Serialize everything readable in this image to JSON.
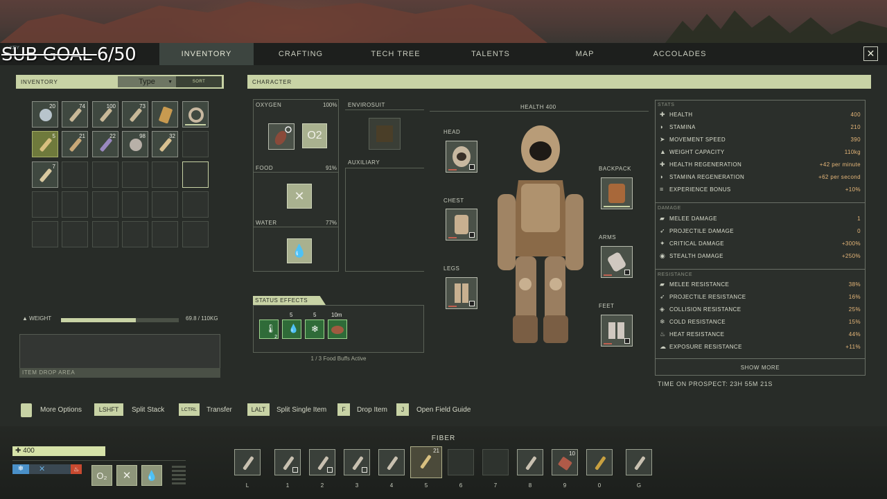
{
  "overlay": {
    "sub_goal": "SUB GOAL ",
    "sub_goal_progress": "6/50",
    "key_hint": "KEY"
  },
  "nav": {
    "tabs": [
      "INVENTORY",
      "CRAFTING",
      "TECH TREE",
      "TALENTS",
      "MAP",
      "ACCOLADES"
    ],
    "active": "INVENTORY",
    "close_label": "✕"
  },
  "inventory": {
    "header": "INVENTORY",
    "type_select": "Type",
    "sort_label": "SORT",
    "slots": [
      {
        "item": "crystal-ore",
        "count": "20",
        "color": "#b8c4cc"
      },
      {
        "item": "arrow-bundle",
        "count": "74",
        "color": "#c8b898"
      },
      {
        "item": "arrow-bundle",
        "count": "100",
        "color": "#c8b898"
      },
      {
        "item": "arrow-bundle",
        "count": "73",
        "color": "#c8b898"
      },
      {
        "item": "bark-slab",
        "count": "",
        "color": "#c89a50"
      },
      {
        "item": "bone-ring",
        "count": "",
        "color": "#c8b8a0"
      },
      {
        "item": "fiber-bundle",
        "count": "5",
        "color": "#d8c080"
      },
      {
        "item": "arrow-bundle",
        "count": "21",
        "color": "#c8a878"
      },
      {
        "item": "arrow-bundle",
        "count": "22",
        "color": "#9a88c0"
      },
      {
        "item": "stone-ore",
        "count": "98",
        "color": "#b8b0a8"
      },
      {
        "item": "bone",
        "count": "32",
        "color": "#d8c090"
      },
      {
        "item": "",
        "count": "",
        "color": ""
      },
      {
        "item": "bone-club",
        "count": "7",
        "color": "#d8c8a0"
      }
    ],
    "weight_label": "WEIGHT",
    "weight_fraction": 0.634,
    "weight_value": "69.8 / 110KG",
    "drop_area_label": "ITEM DROP AREA"
  },
  "key_hints": [
    {
      "key": "",
      "label": "More Options"
    },
    {
      "key": "LSHFT",
      "label": "Split Stack"
    },
    {
      "key": "LCTRL",
      "label": "Transfer"
    },
    {
      "key": "LALT",
      "label": "Split Single Item"
    },
    {
      "key": "F",
      "label": "Drop Item"
    },
    {
      "key": "J",
      "label": "Open Field Guide"
    }
  ],
  "character": {
    "header": "CHARACTER",
    "oxygen": {
      "label": "OXYGEN",
      "value": "100%",
      "tile_text": "O2"
    },
    "food": {
      "label": "FOOD",
      "value": "91%"
    },
    "water": {
      "label": "WATER",
      "value": "77%"
    },
    "envirosuit_label": "ENVIROSUIT",
    "auxiliary_label": "AUXILIARY",
    "health_label": "HEALTH 400",
    "slots": {
      "head": "HEAD",
      "chest": "CHEST",
      "legs": "LEGS",
      "backpack": "BACKPACK",
      "arms": "ARMS",
      "feet": "FEET"
    },
    "status_effects_label": "STATUS EFFECTS",
    "status_effects": [
      {
        "name": "temperature",
        "num": "",
        "sub": "2"
      },
      {
        "name": "water",
        "num": "5",
        "sub": ""
      },
      {
        "name": "cold",
        "num": "5",
        "sub": ""
      },
      {
        "name": "food",
        "num": "10m",
        "sub": ""
      }
    ],
    "food_buffs": "1 / 3 Food Buffs Active"
  },
  "stats": {
    "section_stats": "STATS",
    "stats": [
      {
        "icon": "✚",
        "name": "HEALTH",
        "value": "400"
      },
      {
        "icon": "◗",
        "name": "STAMINA",
        "value": "210"
      },
      {
        "icon": "➤",
        "name": "MOVEMENT SPEED",
        "value": "390"
      },
      {
        "icon": "▲",
        "name": "WEIGHT CAPACITY",
        "value": "110kg"
      },
      {
        "icon": "✚",
        "name": "HEALTH REGENERATION",
        "value": "+42 per minute"
      },
      {
        "icon": "◗",
        "name": "STAMINA REGENERATION",
        "value": "+62 per second"
      },
      {
        "icon": "≡",
        "name": "EXPERIENCE BONUS",
        "value": "+10%"
      }
    ],
    "section_damage": "DAMAGE",
    "damage": [
      {
        "icon": "▰",
        "name": "MELEE DAMAGE",
        "value": "1"
      },
      {
        "icon": "➶",
        "name": "PROJECTILE DAMAGE",
        "value": "0"
      },
      {
        "icon": "✦",
        "name": "CRITICAL DAMAGE",
        "value": "+300%"
      },
      {
        "icon": "◉",
        "name": "STEALTH DAMAGE",
        "value": "+250%"
      }
    ],
    "section_resistance": "RESISTANCE",
    "resistance": [
      {
        "icon": "▰",
        "name": "MELEE RESISTANCE",
        "value": "38%"
      },
      {
        "icon": "➶",
        "name": "PROJECTILE RESISTANCE",
        "value": "16%"
      },
      {
        "icon": "◈",
        "name": "COLLISION RESISTANCE",
        "value": "25%"
      },
      {
        "icon": "❄",
        "name": "COLD RESISTANCE",
        "value": "15%"
      },
      {
        "icon": "♨",
        "name": "HEAT RESISTANCE",
        "value": "44%"
      },
      {
        "icon": "☁",
        "name": "EXPOSURE RESISTANCE",
        "value": "+11%"
      }
    ],
    "show_more": "SHOW MORE",
    "time_on_prospect": "TIME ON PROSPECT: 23H 55M 21S"
  },
  "hotbar": {
    "selected_item_name": "FIBER",
    "slots": [
      {
        "key": "L",
        "item": "torch",
        "count": "",
        "sq": false
      },
      {
        "key": "1",
        "item": "knife",
        "count": "",
        "sq": true
      },
      {
        "key": "2",
        "item": "pickaxe",
        "count": "",
        "sq": true
      },
      {
        "key": "3",
        "item": "axe",
        "count": "",
        "sq": true
      },
      {
        "key": "4",
        "item": "spear",
        "count": "",
        "sq": false
      },
      {
        "key": "5",
        "item": "fiber",
        "count": "21",
        "sq": false
      },
      {
        "key": "6",
        "item": "",
        "count": "",
        "sq": false
      },
      {
        "key": "7",
        "item": "",
        "count": "",
        "sq": false
      },
      {
        "key": "8",
        "item": "sickle",
        "count": "",
        "sq": false
      },
      {
        "key": "9",
        "item": "meat",
        "count": "10",
        "sq": false
      },
      {
        "key": "0",
        "item": "flask",
        "count": "",
        "sq": false
      },
      {
        "key": "G",
        "item": "grenade",
        "count": "",
        "sq": false
      }
    ]
  },
  "hud": {
    "health": "✚ 400"
  }
}
